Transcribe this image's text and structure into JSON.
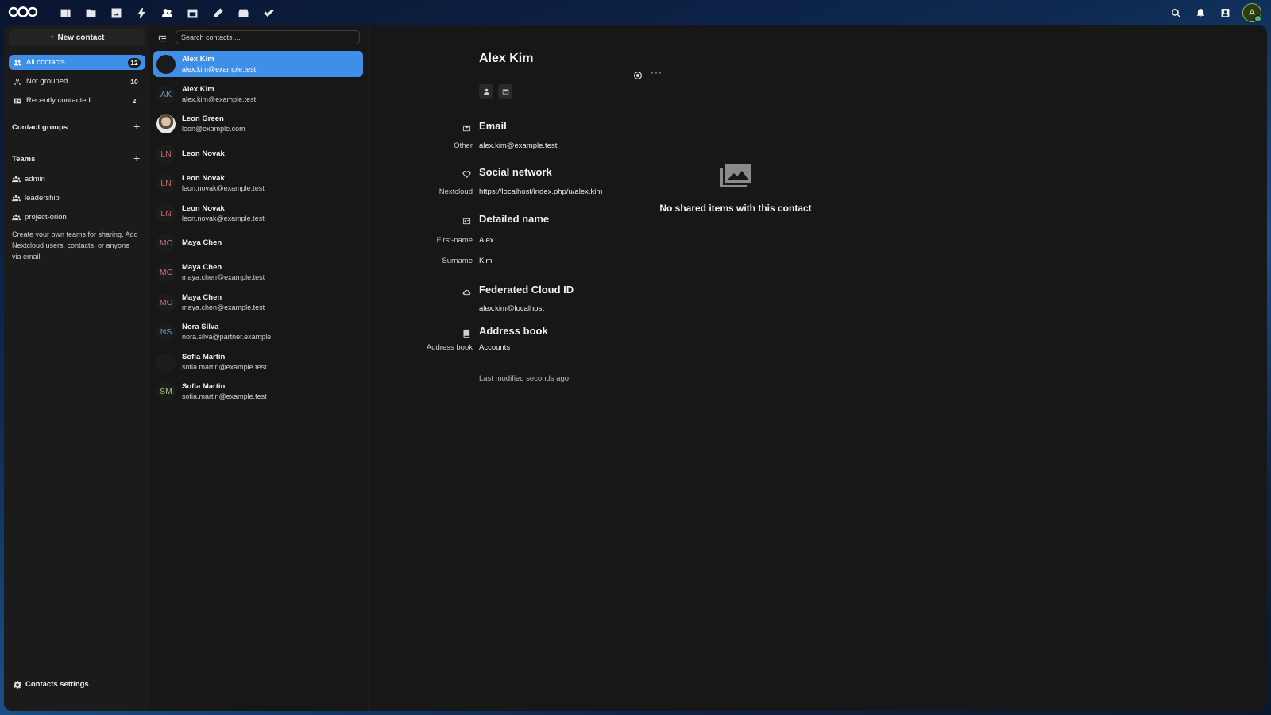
{
  "colors": {
    "accent": "#3f8ee8",
    "background": "#171717"
  },
  "topbar": {
    "apps": [
      "dashboard-icon",
      "files-icon",
      "photos-icon",
      "activity-icon",
      "contacts-icon",
      "calendar-icon",
      "notes-icon",
      "deck-icon",
      "tasks-icon"
    ],
    "right": [
      "search-icon",
      "notifications-icon",
      "contacts-menu-icon"
    ],
    "avatar_initial": "A"
  },
  "nav": {
    "new_contact": "New contact",
    "items": [
      {
        "label": "All contacts",
        "count": "12"
      },
      {
        "label": "Not grouped",
        "count": "10"
      },
      {
        "label": "Recently contacted",
        "count": "2"
      }
    ],
    "contact_groups": "Contact groups",
    "teams_title": "Teams",
    "teams": [
      "admin",
      "leadership",
      "project-orion"
    ],
    "teams_help": "Create your own teams for sharing. Add Nextcloud users, contacts, or anyone via email.",
    "settings": "Contacts settings"
  },
  "list": {
    "search_placeholder": "Search contacts ...",
    "contacts": [
      {
        "name": "Alex Kim",
        "email": "alex.kim@example.test",
        "initials": "",
        "color": "#1c1c1c"
      },
      {
        "name": "Alex Kim",
        "email": "alex.kim@example.test",
        "initials": "AK",
        "color": "#6ba3c9"
      },
      {
        "name": "Leon Green",
        "email": "leon@example.com",
        "initials": "",
        "color": "#ffffff"
      },
      {
        "name": "Leon Novak",
        "email": "",
        "initials": "LN",
        "color": "#c06a6a"
      },
      {
        "name": "Leon Novak",
        "email": "leon.novak@example.test",
        "initials": "LN",
        "color": "#c06a6a"
      },
      {
        "name": "Leon Novak",
        "email": "leon.novak@example.test",
        "initials": "LN",
        "color": "#c06a6a"
      },
      {
        "name": "Maya Chen",
        "email": "",
        "initials": "MC",
        "color": "#c26ea0"
      },
      {
        "name": "Maya Chen",
        "email": "maya.chen@example.test",
        "initials": "MC",
        "color": "#c26ea0"
      },
      {
        "name": "Maya Chen",
        "email": "maya.chen@example.test",
        "initials": "MC",
        "color": "#c26ea0"
      },
      {
        "name": "Nora Silva",
        "email": "nora.silva@partner.example",
        "initials": "NS",
        "color": "#6ba3c9"
      },
      {
        "name": "Sofia Martin",
        "email": "sofia.martin@example.test",
        "initials": "",
        "color": "#171717"
      },
      {
        "name": "Sofia Martin",
        "email": "sofia.martin@example.test",
        "initials": "SM",
        "color": "#9fc27a"
      }
    ]
  },
  "detail": {
    "name": "Alex Kim",
    "sections": {
      "email": {
        "title": "Email",
        "label": "Other",
        "value": "alex.kim@example.test"
      },
      "social": {
        "title": "Social network",
        "label": "Nextcloud",
        "value": "https://localhost/index.php/u/alex.kim"
      },
      "detailed": {
        "title": "Detailed name",
        "first_label": "First-name",
        "first": "Alex",
        "surname_label": "Surname",
        "surname": "Kim"
      },
      "federated": {
        "title": "Federated Cloud ID",
        "value": "alex.kim@localhost"
      },
      "addressbook": {
        "title": "Address book",
        "label": "Address book",
        "value": "Accounts"
      }
    },
    "modified": "Last modified seconds ago",
    "more": "···",
    "shared_empty": "No shared items with this contact"
  }
}
